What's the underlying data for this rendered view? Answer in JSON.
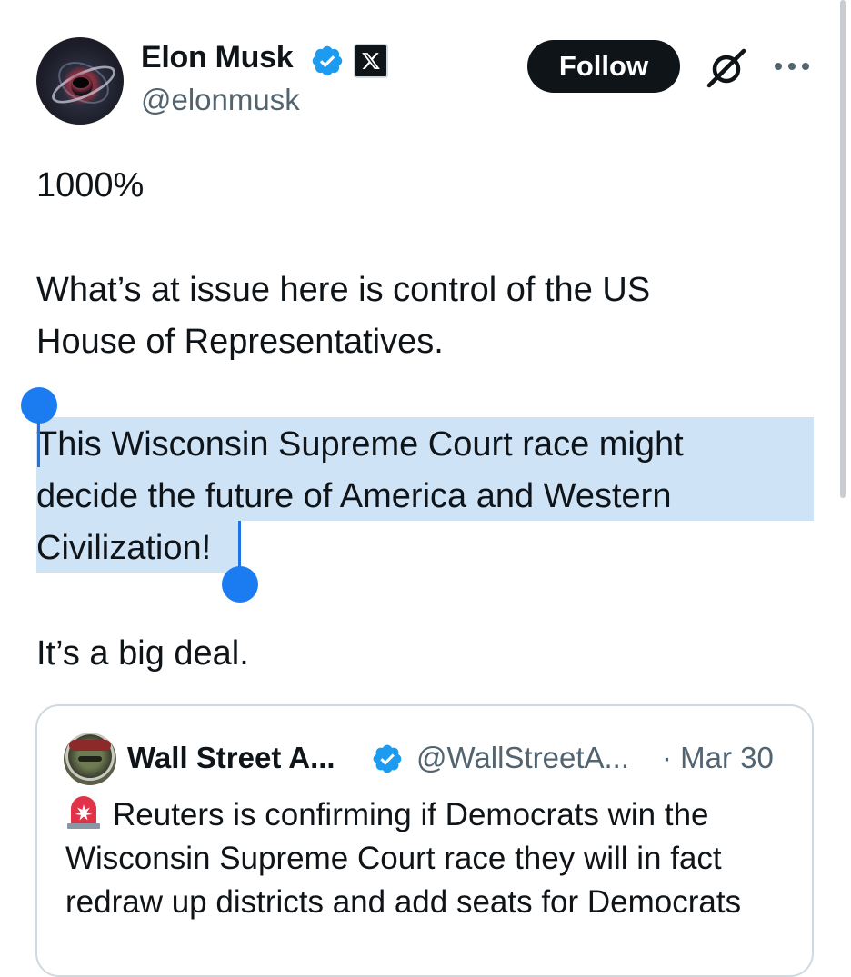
{
  "tweet": {
    "author": {
      "name": "Elon Musk",
      "handle": "@elonmusk",
      "verified_color": "#1d9bf0"
    },
    "follow_label": "Follow",
    "icons": [
      "grok-icon",
      "more-options-icon"
    ],
    "text": {
      "p1": "1000%",
      "p2_line1": "What’s at issue here is control of the US",
      "p2_line2": "House of Representatives.",
      "p3_line1": "This Wisconsin Supreme Court race might",
      "p3_line2": "decide the future of America and Western",
      "p3_line3": "Civilization!",
      "p4": "It’s a big deal."
    },
    "selection_color": "#cfe3f7",
    "selection_handle_color": "#1a7cf0"
  },
  "quote": {
    "author_name": "Wall Street A...",
    "handle": "@WallStreetA...",
    "date": "· Mar 30",
    "text_line1": "Reuters is confirming if Democrats win the",
    "text_line2": "Wisconsin Supreme Court race they will in fact",
    "text_line3": "redraw up districts and add seats for Democrats"
  }
}
